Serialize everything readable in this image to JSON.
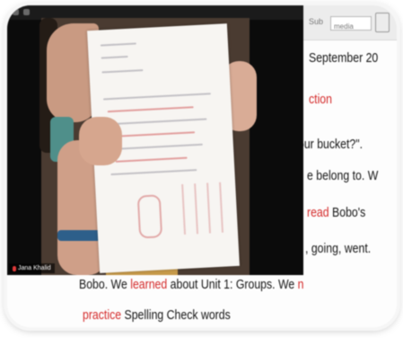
{
  "document": {
    "toolbar_text": "Sub",
    "toolbar_field": "media",
    "lines": [
      {
        "id": "date",
        "segments": [
          {
            "text": "September 20",
            "color": "black"
          }
        ]
      },
      {
        "id": "heading",
        "segments": [
          {
            "text": "ction",
            "color": "red"
          }
        ]
      },
      {
        "id": "line3",
        "segments": [
          {
            "text": "our bucket?\". ",
            "color": "black"
          }
        ]
      },
      {
        "id": "line4",
        "segments": [
          {
            "text": "e belong to. W",
            "color": "black"
          }
        ]
      },
      {
        "id": "line5",
        "segments": [
          {
            "text": "read",
            "color": "red"
          },
          {
            "text": " Bobo's",
            "color": "black"
          }
        ]
      },
      {
        "id": "line6",
        "segments": [
          {
            "text": ", going, went.",
            "color": "black"
          }
        ]
      },
      {
        "id": "line7",
        "segments": [
          {
            "text": "Bobo. We ",
            "color": "black"
          },
          {
            "text": "learned",
            "color": "red"
          },
          {
            "text": " about Unit 1: Groups. We ",
            "color": "black"
          },
          {
            "text": "n",
            "color": "red"
          }
        ]
      },
      {
        "id": "line8",
        "segments": [
          {
            "text": "practice",
            "color": "red"
          },
          {
            "text": " Spelling Check words",
            "color": "black"
          }
        ]
      }
    ]
  },
  "video": {
    "participant_name": "Jana Khalid"
  },
  "colors": {
    "accent_red": "#d42a2a",
    "text": "#151515"
  }
}
